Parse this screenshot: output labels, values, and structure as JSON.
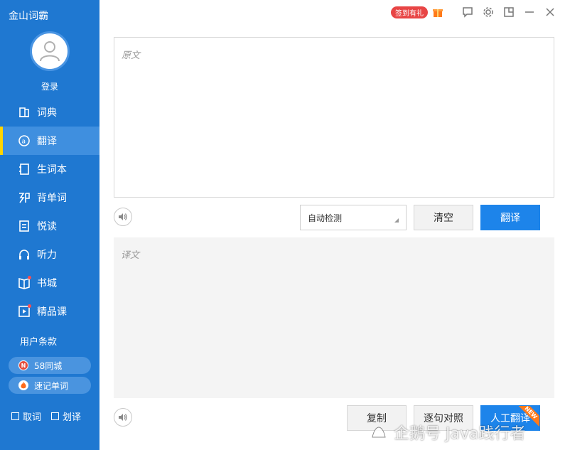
{
  "app": {
    "title": "金山词霸"
  },
  "user": {
    "login_label": "登录"
  },
  "sidebar": {
    "items": [
      {
        "label": "词典",
        "icon": "dictionary-icon",
        "active": false
      },
      {
        "label": "翻译",
        "icon": "translate-icon",
        "active": true
      },
      {
        "label": "生词本",
        "icon": "vocabulary-book-icon",
        "active": false
      },
      {
        "label": "背单词",
        "icon": "memorize-words-icon",
        "active": false
      },
      {
        "label": "悦读",
        "icon": "reading-icon",
        "active": false
      },
      {
        "label": "听力",
        "icon": "headphones-icon",
        "active": false
      },
      {
        "label": "书城",
        "icon": "bookstore-icon",
        "active": false
      },
      {
        "label": "精品课",
        "icon": "video-course-icon",
        "active": false
      }
    ],
    "terms_label": "用户条款",
    "pills": [
      {
        "label": "58同城",
        "icon": "58-logo-icon"
      },
      {
        "label": "速记单词",
        "icon": "flame-icon"
      }
    ],
    "checks": [
      {
        "label": "取词"
      },
      {
        "label": "划译"
      }
    ]
  },
  "topbar": {
    "sign_badge": "签到有礼"
  },
  "translate": {
    "source_placeholder": "原文",
    "target_placeholder": "译文",
    "language_select": "自动检测",
    "clear_label": "清空",
    "translate_label": "翻译",
    "copy_label": "复制",
    "compare_label": "逐句对照",
    "human_label": "人工翻译",
    "new_badge": "NEW"
  },
  "watermark": {
    "text": "企鹅号 Java践行者"
  },
  "colors": {
    "sidebar": "#1f78d1",
    "active_item": "#3f8fdf",
    "active_marker": "#ffd500",
    "primary_button": "#1d84ea",
    "badge_red": "#e84545"
  }
}
